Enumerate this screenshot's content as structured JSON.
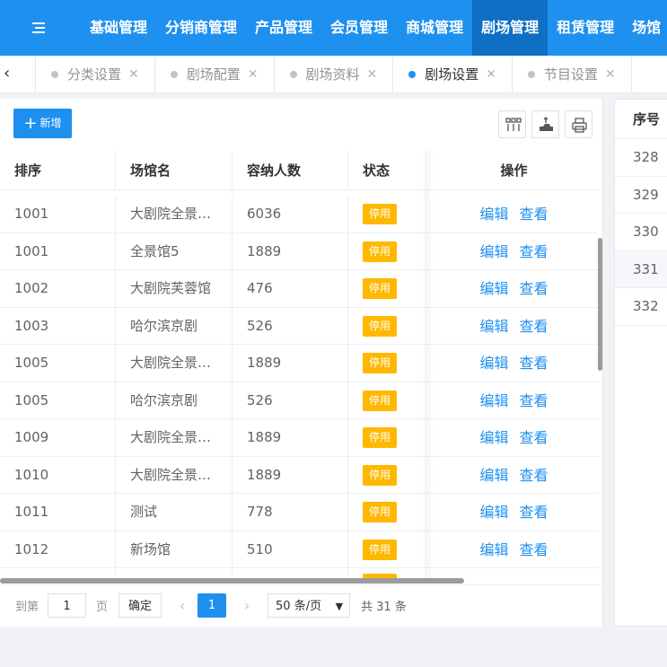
{
  "nav": {
    "items": [
      "基础管理",
      "分销商管理",
      "产品管理",
      "会员管理",
      "商城管理",
      "剧场管理",
      "租赁管理",
      "场馆"
    ],
    "active_index": 5
  },
  "tabs": [
    {
      "label": "分类设置",
      "active": false
    },
    {
      "label": "剧场配置",
      "active": false
    },
    {
      "label": "剧场资料",
      "active": false
    },
    {
      "label": "剧场设置",
      "active": true
    },
    {
      "label": "节目设置",
      "active": false
    }
  ],
  "toolbar": {
    "add_label": "新增"
  },
  "table": {
    "headers": [
      "排序",
      "场馆名",
      "容纳人数",
      "状态",
      "操作"
    ],
    "rows": [
      {
        "sort": "1001",
        "name": "大剧院全景…",
        "capacity": "6036",
        "status": "停用"
      },
      {
        "sort": "1001",
        "name": "全景馆5",
        "capacity": "1889",
        "status": "停用"
      },
      {
        "sort": "1002",
        "name": "大剧院芙蓉馆",
        "capacity": "476",
        "status": "停用"
      },
      {
        "sort": "1003",
        "name": "哈尔滨京剧",
        "capacity": "526",
        "status": "停用"
      },
      {
        "sort": "1005",
        "name": "大剧院全景…",
        "capacity": "1889",
        "status": "停用"
      },
      {
        "sort": "1005",
        "name": "哈尔滨京剧",
        "capacity": "526",
        "status": "停用"
      },
      {
        "sort": "1009",
        "name": "大剧院全景…",
        "capacity": "1889",
        "status": "停用"
      },
      {
        "sort": "1010",
        "name": "大剧院全景…",
        "capacity": "1889",
        "status": "停用"
      },
      {
        "sort": "1011",
        "name": "测试",
        "capacity": "778",
        "status": "停用"
      },
      {
        "sort": "1012",
        "name": "新场馆",
        "capacity": "510",
        "status": "停用"
      }
    ],
    "edit_label": "编辑",
    "view_label": "查看"
  },
  "pagination": {
    "goto_label": "到第",
    "page_input": "1",
    "page_label": "页",
    "confirm_label": "确定",
    "current_page": "1",
    "page_size": "50 条/页",
    "total": "共 31 条"
  },
  "side_table": {
    "header": "序号",
    "rows": [
      "328",
      "329",
      "330",
      "331",
      "332"
    ],
    "highlight_index": 3
  },
  "colors": {
    "primary": "#1e90f0",
    "nav_active": "#0f6fc4",
    "badge": "#ffb800"
  }
}
